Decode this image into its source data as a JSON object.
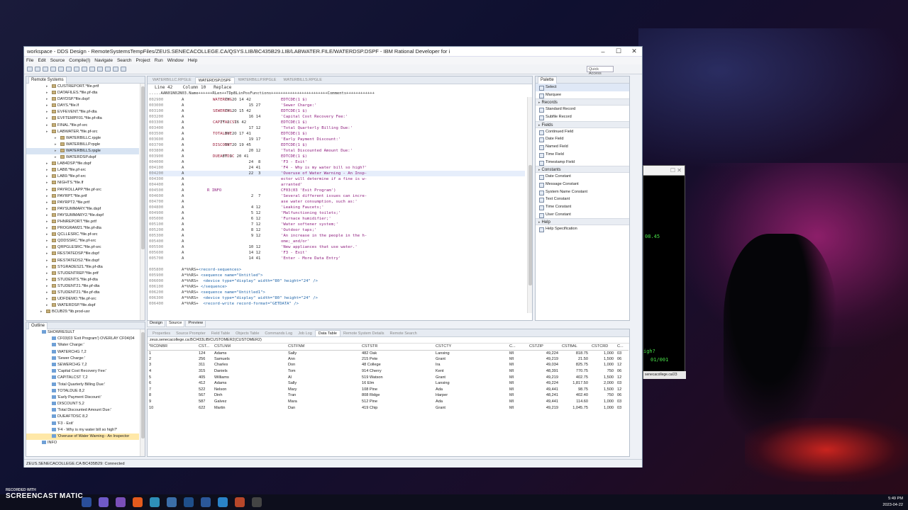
{
  "window": {
    "title": "workspace - DDS Design - RemoteSystemsTempFiles/ZEUS.SENECACOLLEGE.CA/QSYS.LIB/BC435B29.LIB/LABWATER.FILE/WATERDSP.DSPF - IBM Rational Developer for i"
  },
  "menu": [
    "File",
    "Edit",
    "Source",
    "Compile(I)",
    "Navigate",
    "Search",
    "Project",
    "Run",
    "Window",
    "Help"
  ],
  "toolbar": {
    "quick_access": "Quick Access"
  },
  "remote_systems": {
    "title": "Remote Systems",
    "items": [
      {
        "label": "CUSTREPORT.*file.prtf",
        "indent": 1
      },
      {
        "label": "DATAFILES.*file.pf-dta",
        "indent": 1
      },
      {
        "label": "DAYDSP.*file.dspf",
        "indent": 1
      },
      {
        "label": "DAYS.*file.lf",
        "indent": 1
      },
      {
        "label": "EVFEVENT.*file.pf-dta",
        "indent": 1
      },
      {
        "label": "EVFTEMPF01.*file.pf-dta",
        "indent": 1
      },
      {
        "label": "FINAL.*file.pf-src",
        "indent": 1
      },
      {
        "label": "LABWATER.*file.pf-src",
        "indent": 1
      },
      {
        "label": "WATERBILLC.rpgle",
        "indent": 2
      },
      {
        "label": "WATERBILLP.rpgle",
        "indent": 2
      },
      {
        "label": "WATERBILLS.rpgle",
        "indent": 2,
        "sel": true
      },
      {
        "label": "WATERDSP.dspf",
        "indent": 2
      },
      {
        "label": "LAB4DSP.*file.dspf",
        "indent": 1
      },
      {
        "label": "LAB8.*file.pf-src",
        "indent": 1
      },
      {
        "label": "LAB9.*file.pf-src",
        "indent": 1
      },
      {
        "label": "NIGHTS.*file.lf",
        "indent": 1
      },
      {
        "label": "PAYROLLAPP.*file.pf-src",
        "indent": 1
      },
      {
        "label": "PAYRPT.*file.prtf",
        "indent": 1
      },
      {
        "label": "PAYRPT2.*file.prtf",
        "indent": 1
      },
      {
        "label": "PAYSUMMARY.*file.dspf",
        "indent": 1
      },
      {
        "label": "PAYSUMMARY2.*file.dspf",
        "indent": 1
      },
      {
        "label": "PHNREPORT.*file.prtf",
        "indent": 1
      },
      {
        "label": "PROGRAM21.*file.pf-dta",
        "indent": 1
      },
      {
        "label": "QCLLESRC.*file.pf-src",
        "indent": 1
      },
      {
        "label": "QDDSSRC.*file.pf-src",
        "indent": 1
      },
      {
        "label": "QRPGLESRC.*file.pf-src",
        "indent": 1
      },
      {
        "label": "RESTATEDSP.*file.dspf",
        "indent": 1
      },
      {
        "label": "RESTATEDS2.*file.dspf",
        "indent": 1
      },
      {
        "label": "STGRADES21.*file.pf-dta",
        "indent": 1
      },
      {
        "label": "STUDENTREP.*file.prtf",
        "indent": 1
      },
      {
        "label": "STUDENTS.*file.pf-dta",
        "indent": 1
      },
      {
        "label": "STUDENT21.*file.pf-dta",
        "indent": 1
      },
      {
        "label": "STUDENT21.*file.pf-dta",
        "indent": 1
      },
      {
        "label": "UDFDEMO.*file.pf-src",
        "indent": 1
      },
      {
        "label": "WATERDSP.*file.dspf",
        "indent": 1
      },
      {
        "label": "BCUB29.*lib.prod-usr",
        "indent": 0
      }
    ]
  },
  "editor": {
    "tabs": [
      "WATERBILLC.RPGLE",
      "WATERDSP.DSPF",
      "WATERBILLP.RPGLE",
      "WATERBILLS.RPGLE"
    ],
    "active_tab": 1,
    "line": "Line 42",
    "column": "Column 10",
    "mode": "Replace",
    "ruler": ".....AAN01N02N03.Name++++++RLen++TDpBLinPosFunctions++++++++++++++++++++++++Comments++++++++++++",
    "lines": [
      {
        "seq": "002900",
        "spec": "A",
        "name": "WATERCHG",
        "rest": "     7Y 2O 14 42",
        "fn": "EDTCDE(1 $)"
      },
      {
        "seq": "003000",
        "spec": "A",
        "name": "",
        "rest": "               15 27",
        "fn": "'Sewer Charge:'"
      },
      {
        "seq": "003100",
        "spec": "A",
        "name": "SEWERCHG",
        "rest": "     7Y 2O 15 42",
        "fn": "EDTCDE(1 $)"
      },
      {
        "seq": "003200",
        "spec": "A",
        "name": "",
        "rest": "               16 14",
        "fn": "'Capital Cost Recovery Fee:'"
      },
      {
        "seq": "003300",
        "spec": "A",
        "name": "CAPITALCST",
        "rest": "   7Y 2  16 42",
        "fn": "EDTCDE(1 $)"
      },
      {
        "seq": "003400",
        "spec": "A",
        "name": "",
        "rest": "               17 12",
        "fn": "'Total Quarterly Billing Due:'"
      },
      {
        "seq": "003500",
        "spec": "A",
        "name": "TOTALDUE",
        "rest": "     8Y 2O 17 41",
        "fn": "EDTCDE(1 $)"
      },
      {
        "seq": "003600",
        "spec": "A",
        "name": "",
        "rest": "               19 17",
        "fn": "'Early Payment Discount:'"
      },
      {
        "seq": "003700",
        "spec": "A",
        "name": "DISCOUNT",
        "rest": "     5Y 2O 19 45",
        "fn": "EDTCDE(1 $)"
      },
      {
        "seq": "003800",
        "spec": "A",
        "name": "",
        "rest": "               20 12",
        "fn": "'Total Discounted Amount Due:'"
      },
      {
        "seq": "003900",
        "spec": "A",
        "name": "DUEAFTDSC",
        "rest": "    8Y 2  20 41",
        "fn": "EDTCDE(1 $)"
      },
      {
        "seq": "004000",
        "spec": "A",
        "name": "",
        "rest": "               24  8",
        "fn": "'F3 - Exit'"
      },
      {
        "seq": "004100",
        "spec": "A",
        "name": "",
        "rest": "               24 41",
        "fn": "'F4 - Why is my water bill so high?'"
      },
      {
        "seq": "004200",
        "spec": "A",
        "name": "",
        "rest": "               22  3",
        "fn": "'Overuse of Water Warning - An Insp-",
        "cur": true
      },
      {
        "seq": "004300",
        "spec": "A",
        "name": "",
        "rest": "                    ",
        "fn": "ector will determine if a fine is w-"
      },
      {
        "seq": "004400",
        "spec": "A",
        "name": "",
        "rest": "                    ",
        "fn": "arranted'"
      },
      {
        "seq": "004500",
        "spec": "A",
        "name": "",
        "rest": "                    ",
        "fn": "CF03(03 'Exit Program')",
        "rec": "R INFO"
      },
      {
        "seq": "004600",
        "spec": "A",
        "name": "",
        "rest": "                2  7",
        "fn": "'Several different issues can incre-"
      },
      {
        "seq": "004700",
        "spec": "A",
        "name": "",
        "rest": "                    ",
        "fn": "ase water consumption, such as:'"
      },
      {
        "seq": "004800",
        "spec": "A",
        "name": "",
        "rest": "                4 12",
        "fn": "'Leaking Faucets;'"
      },
      {
        "seq": "004900",
        "spec": "A",
        "name": "",
        "rest": "                5 12",
        "fn": "'Malfunctioning toilets;'"
      },
      {
        "seq": "005000",
        "spec": "A",
        "name": "",
        "rest": "                6 12",
        "fn": "'Furnace humidifier;'"
      },
      {
        "seq": "005100",
        "spec": "A",
        "name": "",
        "rest": "                7 12",
        "fn": "'Water softener system;'"
      },
      {
        "seq": "005200",
        "spec": "A",
        "name": "",
        "rest": "                8 12",
        "fn": "'Outdoor taps;'"
      },
      {
        "seq": "005300",
        "spec": "A",
        "name": "",
        "rest": "                9 12",
        "fn": "'An increase in the people in the h-"
      },
      {
        "seq": "005400",
        "spec": "A",
        "name": "",
        "rest": "                    ",
        "fn": "ome;_and/or'"
      },
      {
        "seq": "005500",
        "spec": "A",
        "name": "",
        "rest": "               10 12",
        "fn": "'New appliances that use water.'"
      },
      {
        "seq": "005600",
        "spec": "A",
        "name": "",
        "rest": "               14 12",
        "fn": "'F3 - Exit'"
      },
      {
        "seq": "005700",
        "spec": "A",
        "name": "",
        "rest": "               14 41",
        "fn": "'Enter - More Data Entry'"
      },
      {
        "seq": "",
        "spec": "",
        "name": "",
        "rest": "",
        "fn": ""
      },
      {
        "seq": "005800",
        "spec": "A*%%RS+",
        "name": "",
        "rest": "",
        "fn": "",
        "cmt": "<record-sequences>"
      },
      {
        "seq": "005900",
        "spec": "A*%%RS+",
        "name": "",
        "rest": "",
        "fn": "",
        "cmt": " <sequence name=\"Untitled\">"
      },
      {
        "seq": "006000",
        "spec": "A*%%RS+",
        "name": "",
        "rest": "",
        "fn": "",
        "cmt": "  <device type=\"display\" width=\"80\" height=\"24\" />"
      },
      {
        "seq": "006100",
        "spec": "A*%%RS+",
        "name": "",
        "rest": "",
        "fn": "",
        "cmt": " </sequence>"
      },
      {
        "seq": "006200",
        "spec": "A*%%RS+",
        "name": "",
        "rest": "",
        "fn": "",
        "cmt": " <sequence name=\"Untitled1\">"
      },
      {
        "seq": "006300",
        "spec": "A*%%RS+",
        "name": "",
        "rest": "",
        "fn": "",
        "cmt": "  <device type=\"display\" width=\"80\" height=\"24\" />"
      },
      {
        "seq": "006400",
        "spec": "A*%%RS+",
        "name": "",
        "rest": "",
        "fn": "",
        "cmt": "  <record-write record-format=\"GETDATA\" />"
      }
    ],
    "bottom_tabs": [
      "Design",
      "Source",
      "Preview"
    ]
  },
  "palette": {
    "title": "Palette",
    "top": [
      "Select",
      "Marquee"
    ],
    "sections": [
      {
        "name": "Records",
        "items": [
          "Standard Record",
          "Subfile Record"
        ]
      },
      {
        "name": "Fields",
        "items": [
          "Continued Field",
          "Date Field",
          "Named Field",
          "Time Field",
          "Timestamp Field"
        ]
      },
      {
        "name": "Constants",
        "items": [
          "Date Constant",
          "Message Constant",
          "System Name Constant",
          "Text Constant",
          "Time Constant",
          "User Constant"
        ]
      },
      {
        "name": "Help",
        "items": [
          "Help Specification"
        ]
      }
    ]
  },
  "outline": {
    "title": "Outline",
    "items": [
      {
        "label": "SHOWRESULT",
        "indent": 0
      },
      {
        "label": "CF03(03 'Exit Program') OVERLAY CF04(04",
        "indent": 1
      },
      {
        "label": "'Water Charge:'",
        "indent": 1
      },
      {
        "label": "WATERCHG 7,2",
        "indent": 1
      },
      {
        "label": "'Sewer Charge:'",
        "indent": 1
      },
      {
        "label": "SEWERCHG 7,2",
        "indent": 1
      },
      {
        "label": "'Capital Cost Recovery Fee:'",
        "indent": 1
      },
      {
        "label": "CAPITALCST 7,2",
        "indent": 1
      },
      {
        "label": "'Total Quarterly Billing Due:'",
        "indent": 1
      },
      {
        "label": "TOTALDUE 8,2",
        "indent": 1
      },
      {
        "label": "'Early Payment Discount:'",
        "indent": 1
      },
      {
        "label": "DISCOUNT 5,2",
        "indent": 1
      },
      {
        "label": "'Total Discounted Amount Due:'",
        "indent": 1
      },
      {
        "label": "DUEAFTDSC 8,2",
        "indent": 1
      },
      {
        "label": "'F3 - Exit'",
        "indent": 1
      },
      {
        "label": "'F4 - Why is my water bill so high?'",
        "indent": 1
      },
      {
        "label": "'Overuse of Water Warning - An Inspector",
        "indent": 1,
        "hl": true
      },
      {
        "label": "INFO",
        "indent": 0
      }
    ]
  },
  "bottom": {
    "tabs": [
      "Properties",
      "Source Prompter",
      "Field Table",
      "Objects Table",
      "Commands Log",
      "Job Log",
      "Data Table",
      "Remote System Details",
      "Remote Search"
    ],
    "active_tab": 6,
    "source": "zeus.senecacollege.ca:BCI433LIB/CUSTOMER2(CUSTOMER2)",
    "columns": [
      "*RCDNBR",
      "CST...",
      "CSTLNM",
      "CSTFNM",
      "CSTSTR",
      "CSTCTY",
      "C...",
      "CSTZIP",
      "CSTBAL",
      "CSTCRD",
      "C..."
    ],
    "rows": [
      [
        "1",
        "124",
        "Adams",
        "Sally",
        "482 Oak",
        "Lansing",
        "MI",
        "49,224",
        "818.75",
        "1,000",
        "03"
      ],
      [
        "2",
        "256",
        "Samuels",
        "Ann",
        "215 Pete",
        "Grant",
        "MI",
        "49,219",
        "21.50",
        "1,500",
        "06"
      ],
      [
        "3",
        "311",
        "Charles",
        "Don",
        "48 College",
        "Ira",
        "MI",
        "49,034",
        "825.75",
        "1,000",
        "12"
      ],
      [
        "4",
        "315",
        "Daniels",
        "Tom",
        "914 Cherry",
        "Kent",
        "MI",
        "48,391",
        "770.75",
        "750",
        "06"
      ],
      [
        "5",
        "405",
        "Williams",
        "Al",
        "519 Watson",
        "Grant",
        "MI",
        "49,219",
        "402.75",
        "1,500",
        "12"
      ],
      [
        "6",
        "412",
        "Adams",
        "Sally",
        "16 Elm",
        "Lansing",
        "MI",
        "49,224",
        "1,817.50",
        "2,000",
        "03"
      ],
      [
        "7",
        "522",
        "Nelson",
        "Mary",
        "108 Pine",
        "Ada",
        "MI",
        "49,441",
        "98.75",
        "1,500",
        "12"
      ],
      [
        "8",
        "567",
        "Dinh",
        "Tran",
        "808 Ridge",
        "Harper",
        "MI",
        "48,241",
        "402.40",
        "750",
        "06"
      ],
      [
        "9",
        "587",
        "Galvez",
        "Mara",
        "512 Pine",
        "Ada",
        "MI",
        "49,441",
        "114.60",
        "1,000",
        "03"
      ],
      [
        "10",
        "622",
        "Martin",
        "Dan",
        "419 Chip",
        "Grant",
        "MI",
        "49,219",
        "1,045.75",
        "1,000",
        "03"
      ]
    ]
  },
  "status": "ZEUS.SENECACOLLEGE.CA BC435B29: Connected",
  "terminal": {
    "l1": "08.45",
    "l2": "igh?",
    "l3": "01/001",
    "tab": "senecacollege.ca/23"
  },
  "recorder": {
    "a": "RECORDED WITH",
    "b": "SCREENCAST",
    "c": "MATIC"
  },
  "clock": {
    "time": "5:49 PM",
    "date": "2023-04-22"
  }
}
